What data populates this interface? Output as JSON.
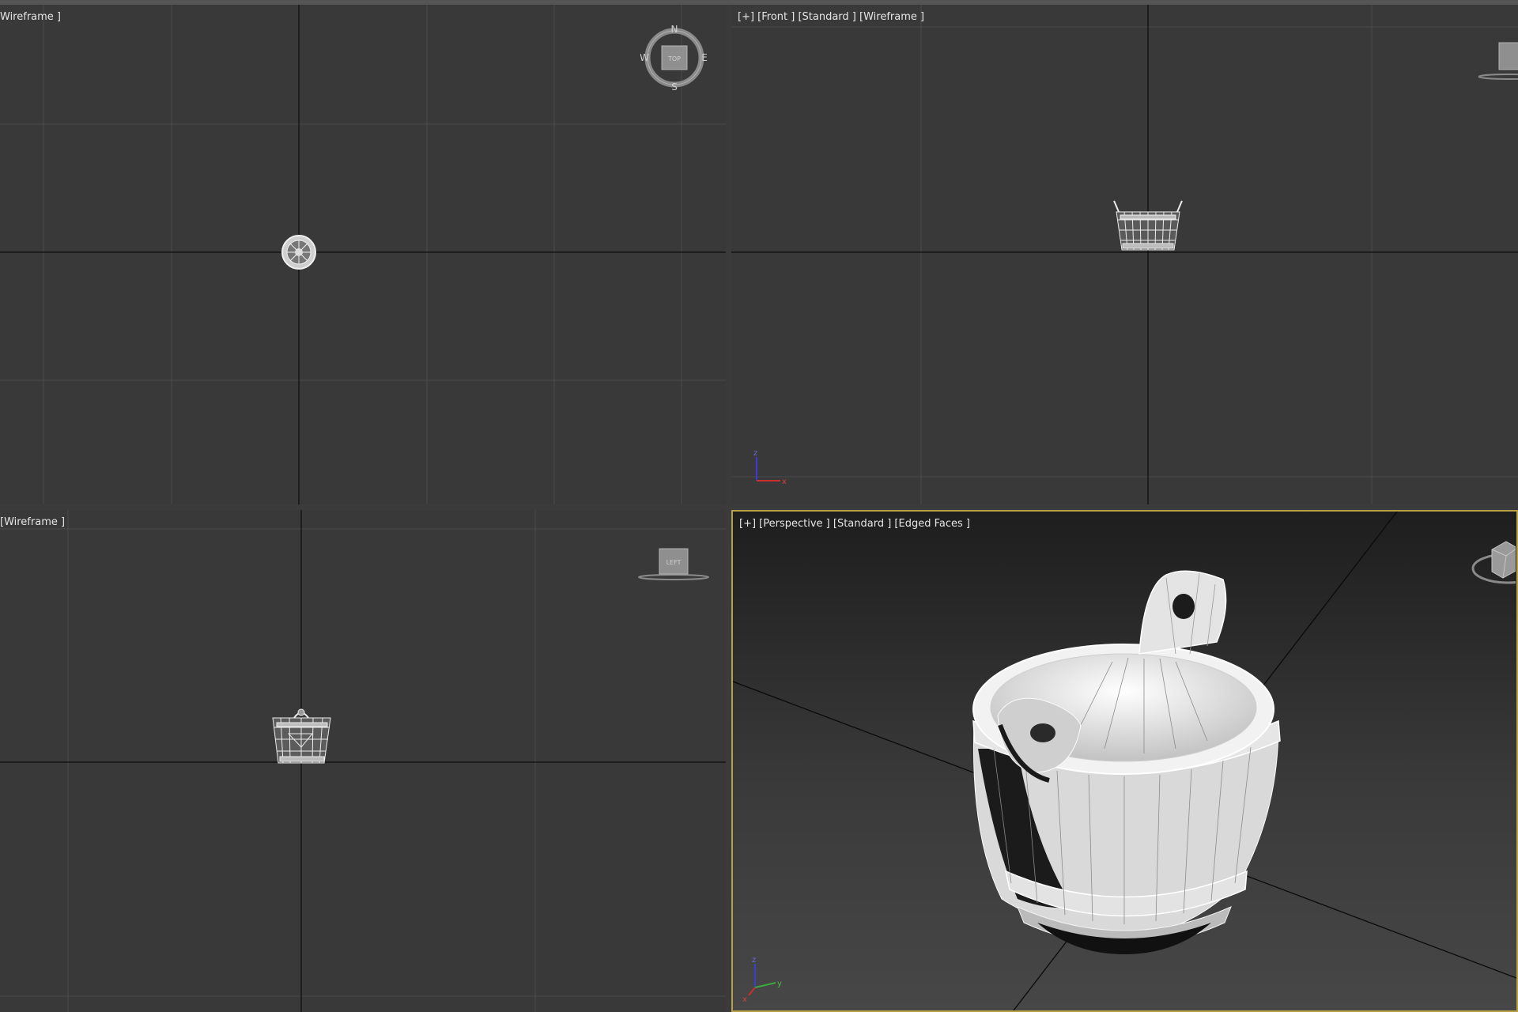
{
  "viewports": {
    "top": {
      "label": "Wireframe ]"
    },
    "front": {
      "label": "[+] [Front ] [Standard ] [Wireframe ]"
    },
    "left": {
      "label": "[Wireframe ]"
    },
    "perspective": {
      "label": "[+] [Perspective ] [Standard ] [Edged Faces ]"
    }
  },
  "viewcube": {
    "top_face": "TOP",
    "left_face": "LEFT",
    "compass": {
      "north": "N",
      "south": "S",
      "east": "E",
      "west": "W"
    }
  },
  "axis_gizmo": {
    "z": "z",
    "x": "x",
    "y": "y"
  },
  "colors": {
    "viewport_bg": "#393939",
    "grid_line": "#4a4a4a",
    "home_grid_axis": "#0c0c0c",
    "active_border": "#b8a046",
    "wire": "#e8e8e8",
    "axis_x": "#c83030",
    "axis_y": "#3caa3c",
    "axis_z": "#3c3cd2"
  },
  "icons": {
    "viewcube": "viewcube-icon",
    "compass": "compass-icon",
    "axis_tripod": "axis-tripod-icon",
    "bucket": "bucket-model"
  }
}
